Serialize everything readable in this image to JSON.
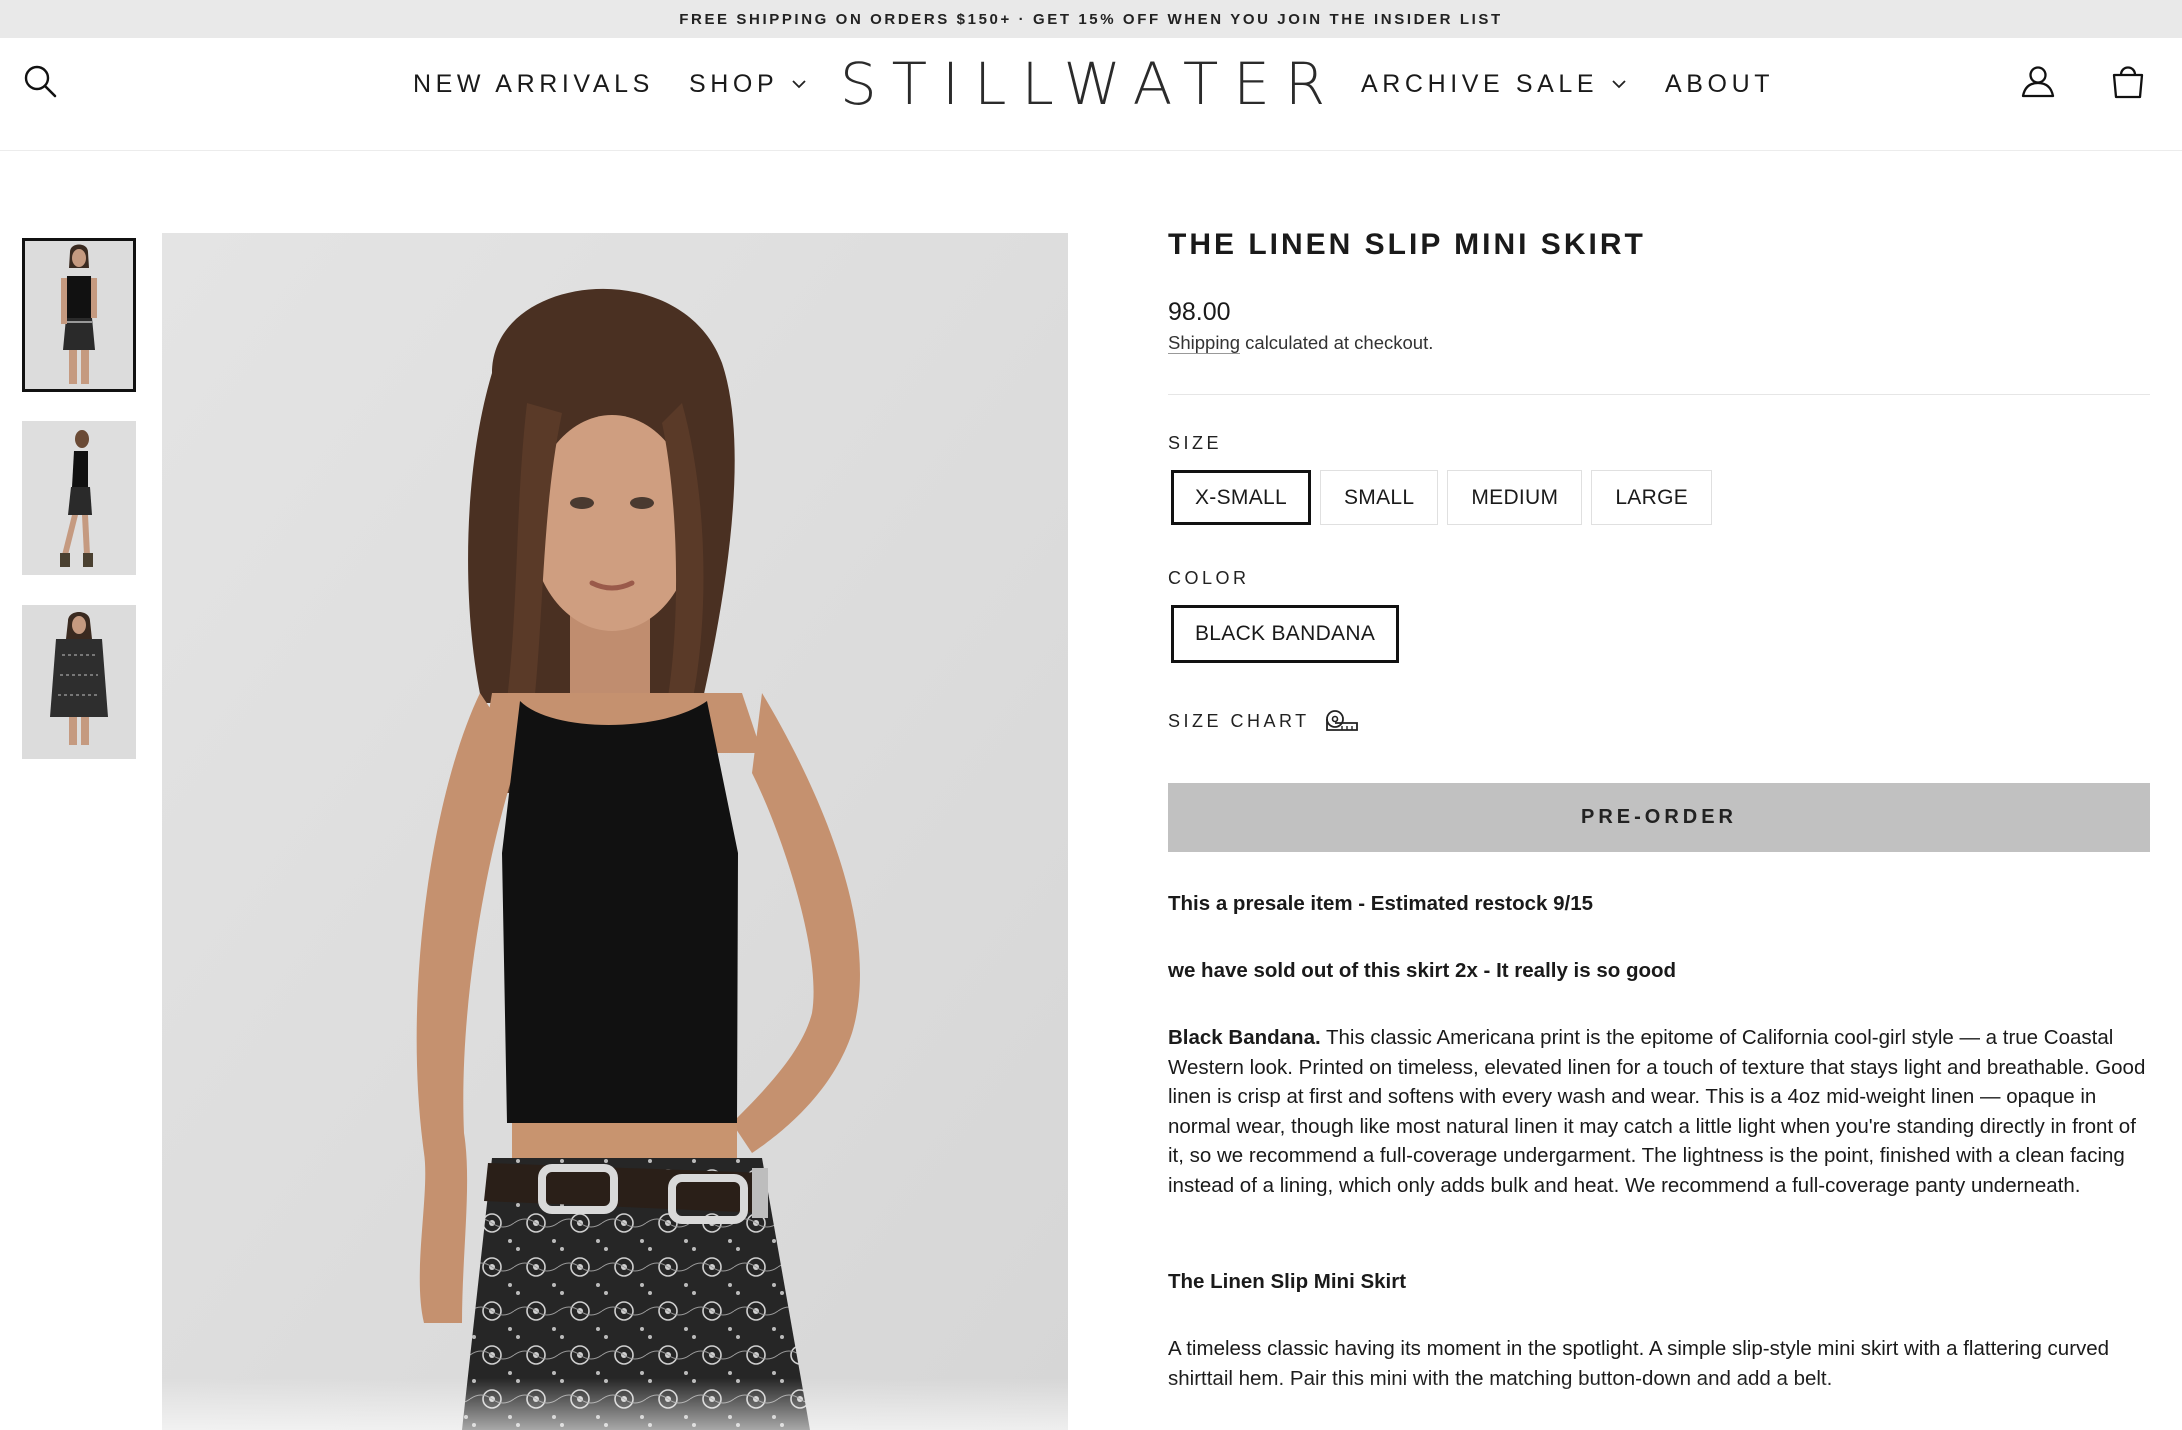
{
  "announcement": "FREE SHIPPING ON ORDERS $150+ · GET 15% OFF WHEN YOU JOIN THE INSIDER LIST",
  "nav": {
    "new_arrivals": "NEW ARRIVALS",
    "shop": "SHOP",
    "archive_sale": "ARCHIVE SALE",
    "about": "ABOUT"
  },
  "brand": {
    "logo": "STILLWATER"
  },
  "header_icons": [
    "search-icon",
    "account-icon",
    "cart-icon"
  ],
  "product": {
    "title": "THE LINEN SLIP MINI SKIRT",
    "price": "98.00",
    "shipping_link": "Shipping",
    "shipping_rest": " calculated at checkout.",
    "size_label": "SIZE",
    "sizes": [
      "X-SMALL",
      "SMALL",
      "MEDIUM",
      "LARGE"
    ],
    "selected_size": "X-SMALL",
    "color_label": "COLOR",
    "colors": [
      "BLACK BANDANA"
    ],
    "selected_color": "BLACK BANDANA",
    "size_chart": "SIZE CHART",
    "cta": "PRE-ORDER",
    "desc_1": "This a presale item - Estimated restock 9/15",
    "desc_2": "we have sold out of this skirt 2x - It really is so good",
    "desc_3_bold": "Black Bandana.",
    "desc_3": " This classic Americana print is the epitome of California cool-girl style — a true Coastal Western look. Printed on timeless, elevated linen for a touch of texture that stays light and breathable. Good linen is crisp at first and softens with every wash and wear. This is a 4oz mid-weight linen — opaque in normal wear, though like most natural linen it may catch a little light when you're standing directly in front of it, so we recommend a full-coverage undergarment. The lightness is the point, finished with a clean facing instead of a lining, which only adds bulk and heat. We recommend a full-coverage panty underneath.",
    "desc_4": "The Linen Slip Mini Skirt",
    "desc_5": "A timeless classic having its moment in the spotlight. A simple slip-style mini skirt with a flattering curved shirttail hem. Pair this mini with the matching button-down and add a belt."
  },
  "colors": {
    "announcement_bg": "#e9e9e9",
    "button_bg": "#c1c1c1",
    "text": "#111111"
  }
}
